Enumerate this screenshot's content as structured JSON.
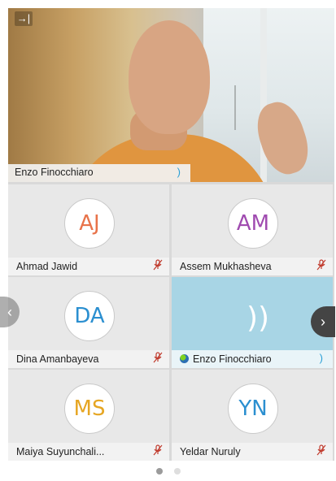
{
  "speaker": {
    "name": "Enzo Finocchiaro",
    "exit_icon": "→|",
    "speaking_icon": ")"
  },
  "tiles": [
    {
      "initials": "AJ",
      "name": "Ahmad Jawid",
      "initials_color": "#e8734a",
      "muted": true
    },
    {
      "initials": "AM",
      "name": "Assem Mukhasheva",
      "initials_color": "#a04bb0",
      "muted": true
    },
    {
      "initials": "DA",
      "name": "Dina Amanbayeva",
      "initials_color": "#2b8fd0",
      "muted": true
    },
    {
      "name": "Enzo Finocchiaro",
      "speaking": true,
      "wave": "))"
    },
    {
      "initials": "MS",
      "name": "Maiya Suyunchali...",
      "initials_color": "#e6a623",
      "muted": true
    },
    {
      "initials": "YN",
      "name": "Yeldar Nuruly",
      "initials_color": "#2b8fd0",
      "muted": true
    }
  ],
  "icons": {
    "mic_muted": "🎙̸",
    "prev": "‹",
    "next": "›"
  },
  "pager": {
    "pages": 2,
    "current": 1
  }
}
